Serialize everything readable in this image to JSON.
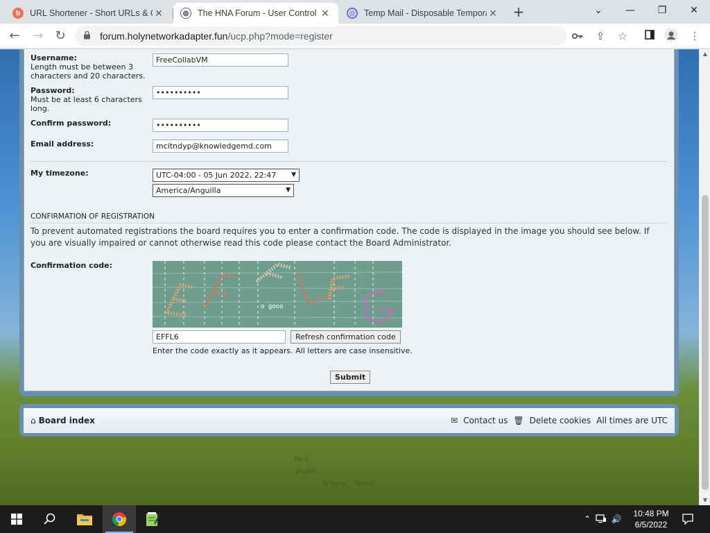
{
  "browser": {
    "tabs": [
      {
        "title": "URL Shortener - Short URLs & Cu",
        "active": false
      },
      {
        "title": "The HNA Forum - User Control P",
        "active": true
      },
      {
        "title": "Temp Mail - Disposable Tempora",
        "active": false
      }
    ],
    "url_host": "forum.holynetworkadapter.fun",
    "url_path": "/ucp.php?mode=register"
  },
  "form": {
    "username": {
      "label": "Username:",
      "hint": "Length must be between 3 characters and 20 characters.",
      "value": "FreeCollabVM"
    },
    "password": {
      "label": "Password:",
      "hint": "Must be at least 6 characters long.",
      "value": "••••••••••"
    },
    "confirm_password": {
      "label": "Confirm password:",
      "value": "••••••••••"
    },
    "email": {
      "label": "Email address:",
      "value": "mcitndyp@knowledgemd.com"
    },
    "timezone": {
      "label": "My timezone:",
      "offset": "UTC-04:00 - 05 Jun 2022, 22:47",
      "zone": "America/Anguilla"
    },
    "confirmation": {
      "heading": "CONFIRMATION OF REGISTRATION",
      "explain": "To prevent automated registrations the board requires you to enter a confirmation code. The code is displayed in the image you should see below. If you are visually impaired or cannot otherwise read this code please contact the Board Administrator.",
      "label": "Confirmation code:",
      "captcha_text": "EFFLG",
      "value": "EFFL6",
      "refresh_label": "Refresh confirmation code",
      "hint": "Enter the code exactly as it appears. All letters are case insensitive."
    },
    "submit_label": "Submit"
  },
  "footer": {
    "board_index": "Board index",
    "contact": "Contact us",
    "delete_cookies": "Delete cookies",
    "times": "All times are UTC",
    "faint_lines": [
      "Aero",
      "phpBB",
      "Privacy",
      "Terms"
    ]
  },
  "taskbar": {
    "time": "10:48 PM",
    "date": "6/5/2022"
  }
}
